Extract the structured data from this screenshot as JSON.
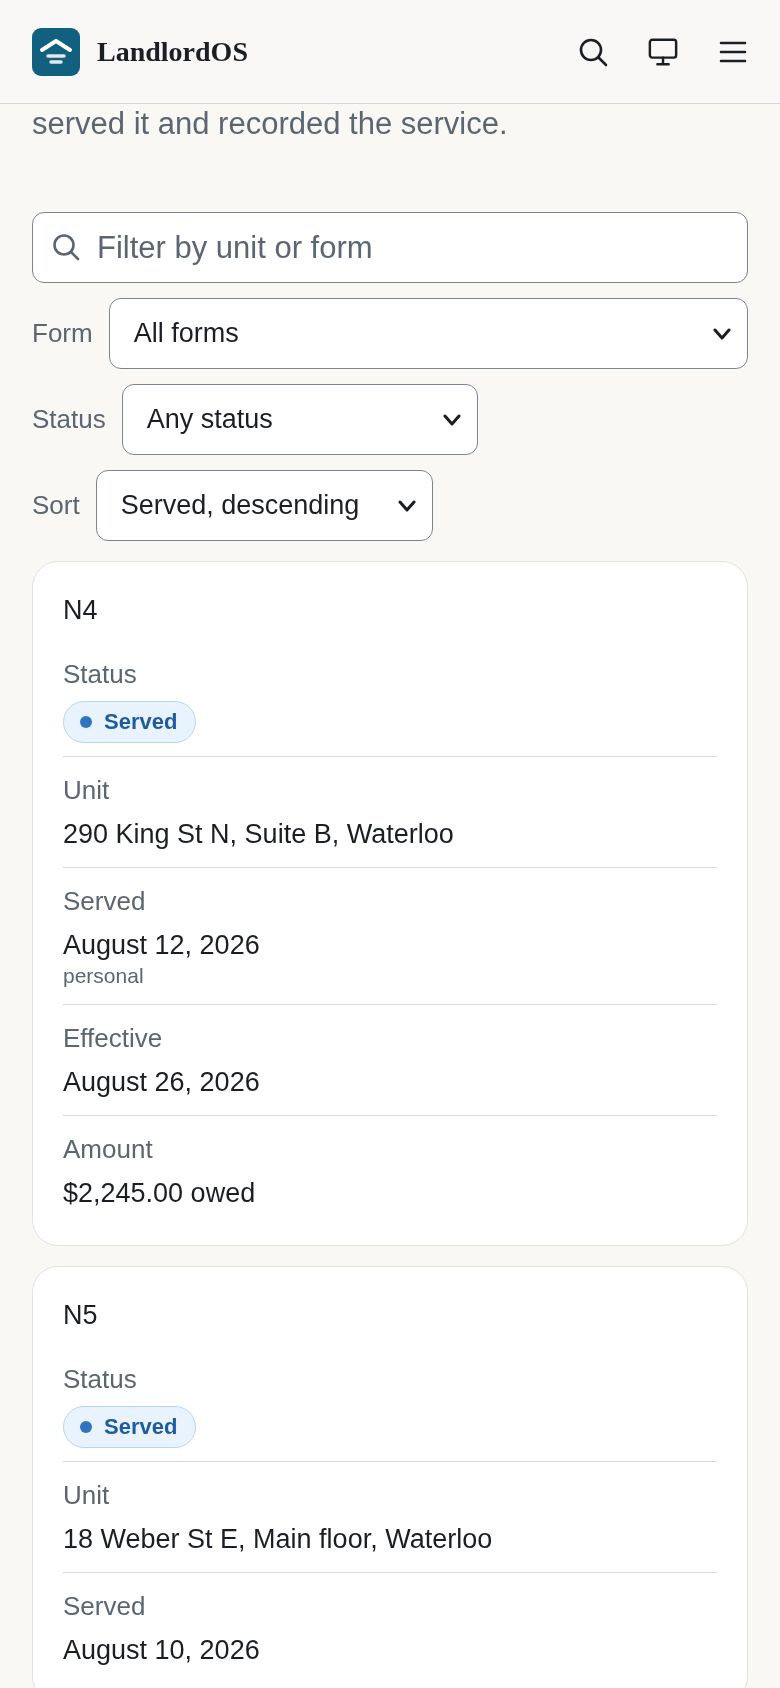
{
  "header": {
    "brand": "LandlordOS"
  },
  "intro": {
    "lines": [
      "served it and recorded the service."
    ]
  },
  "filters": {
    "search": {
      "placeholder": "Filter by unit or form"
    },
    "selects": [
      {
        "label": "Form",
        "value": "All forms"
      },
      {
        "label": "Status",
        "value": "Any status"
      },
      {
        "label": "Sort",
        "value": "Served, descending"
      }
    ]
  },
  "notices": [
    {
      "form": "N4",
      "fields": [
        {
          "kind": "badge",
          "label": "Status",
          "value": "Served"
        },
        {
          "kind": "text",
          "label": "Unit",
          "value": "290 King St N, Suite B, Waterloo"
        },
        {
          "kind": "text",
          "label": "Served",
          "value": "August 12, 2026",
          "note": "personal"
        },
        {
          "kind": "text",
          "label": "Effective",
          "value": "August 26, 2026"
        },
        {
          "kind": "text",
          "label": "Amount",
          "value": "$2,245.00 owed"
        }
      ]
    },
    {
      "form": "N5",
      "fields": [
        {
          "kind": "badge",
          "label": "Status",
          "value": "Served"
        },
        {
          "kind": "text",
          "label": "Unit",
          "value": "18 Weber St E, Main floor, Waterloo"
        },
        {
          "kind": "text",
          "label": "Served",
          "value": "August 10, 2026"
        }
      ]
    }
  ]
}
